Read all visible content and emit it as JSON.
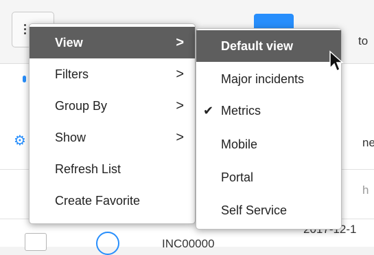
{
  "background": {
    "right_fragments": [
      "to",
      "ne",
      "h"
    ],
    "date_fragment": "2017-12-1",
    "number_fragment": "INC00000"
  },
  "primary_menu": {
    "items": [
      {
        "label": "View",
        "has_submenu": true,
        "active": true
      },
      {
        "label": "Filters",
        "has_submenu": true,
        "active": false
      },
      {
        "label": "Group By",
        "has_submenu": true,
        "active": false
      },
      {
        "label": "Show",
        "has_submenu": true,
        "active": false
      },
      {
        "label": "Refresh List",
        "has_submenu": false,
        "active": false
      },
      {
        "label": "Create Favorite",
        "has_submenu": false,
        "active": false
      }
    ],
    "arrow_glyph": ">"
  },
  "view_submenu": {
    "items": [
      {
        "label": "Default view",
        "active": true,
        "checked": false
      },
      {
        "label": "Major incidents",
        "active": false,
        "checked": false
      },
      {
        "label": "Metrics",
        "active": false,
        "checked": true
      },
      {
        "label": "Mobile",
        "active": false,
        "checked": false
      },
      {
        "label": "Portal",
        "active": false,
        "checked": false
      },
      {
        "label": "Self Service",
        "active": false,
        "checked": false
      }
    ],
    "check_glyph": "✔"
  },
  "colors": {
    "active_item_bg": "#5e5e5e",
    "accent_blue": "#278efc"
  }
}
